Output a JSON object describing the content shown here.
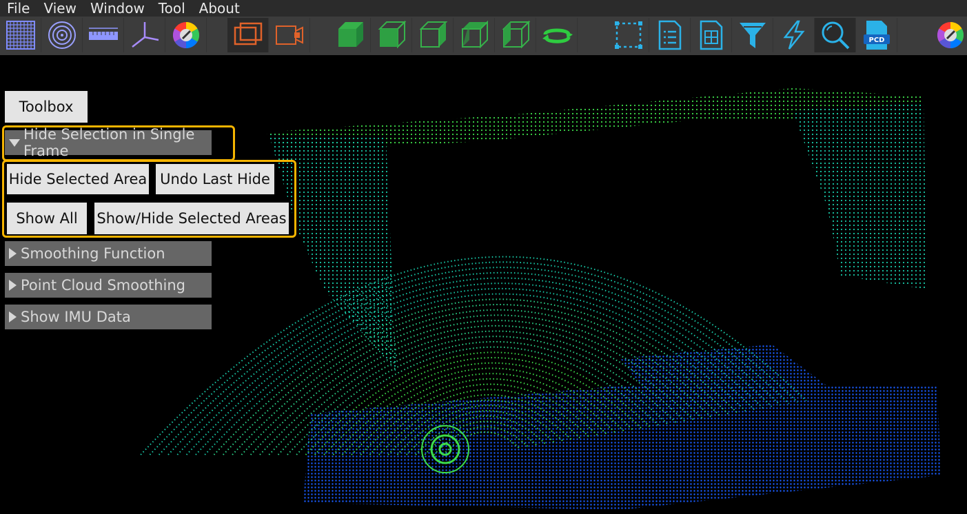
{
  "menu": [
    "File",
    "View",
    "Window",
    "Tool",
    "About"
  ],
  "toolbar": {
    "groups": [
      [
        "grid-icon",
        "radar-rings-icon",
        "ruler-icon",
        "axes-icon",
        "color-wheel-icon"
      ],
      [
        "box-frame-icon",
        "camera-box-icon"
      ],
      [
        "cube-icon",
        "cube-front-icon",
        "cube-side-icon",
        "cube-top-icon",
        "cube-back-icon",
        "rotate-icon"
      ],
      [
        "selection-rect-icon",
        "list-doc-icon",
        "grid-doc-icon",
        "filter-icon",
        "lightning-icon",
        "search-icon",
        "pcd-file-icon"
      ],
      [
        "color-wheel-icon"
      ]
    ],
    "pcd_label": "PCD"
  },
  "toolbox": {
    "title": "Toolbox",
    "hide_section": {
      "header": "Hide Selection in Single Frame",
      "buttons": [
        "Hide Selected Area",
        "Undo Last Hide",
        "Show All",
        "Show/Hide Selected Areas"
      ]
    },
    "sections": [
      "Smoothing Function",
      "Point Cloud Smoothing",
      "Show IMU Data"
    ]
  },
  "colors": {
    "highlight": "#f5b400",
    "point_green": "#3ddc4a",
    "point_teal": "#18c9a8",
    "point_blue": "#1a5cff"
  }
}
